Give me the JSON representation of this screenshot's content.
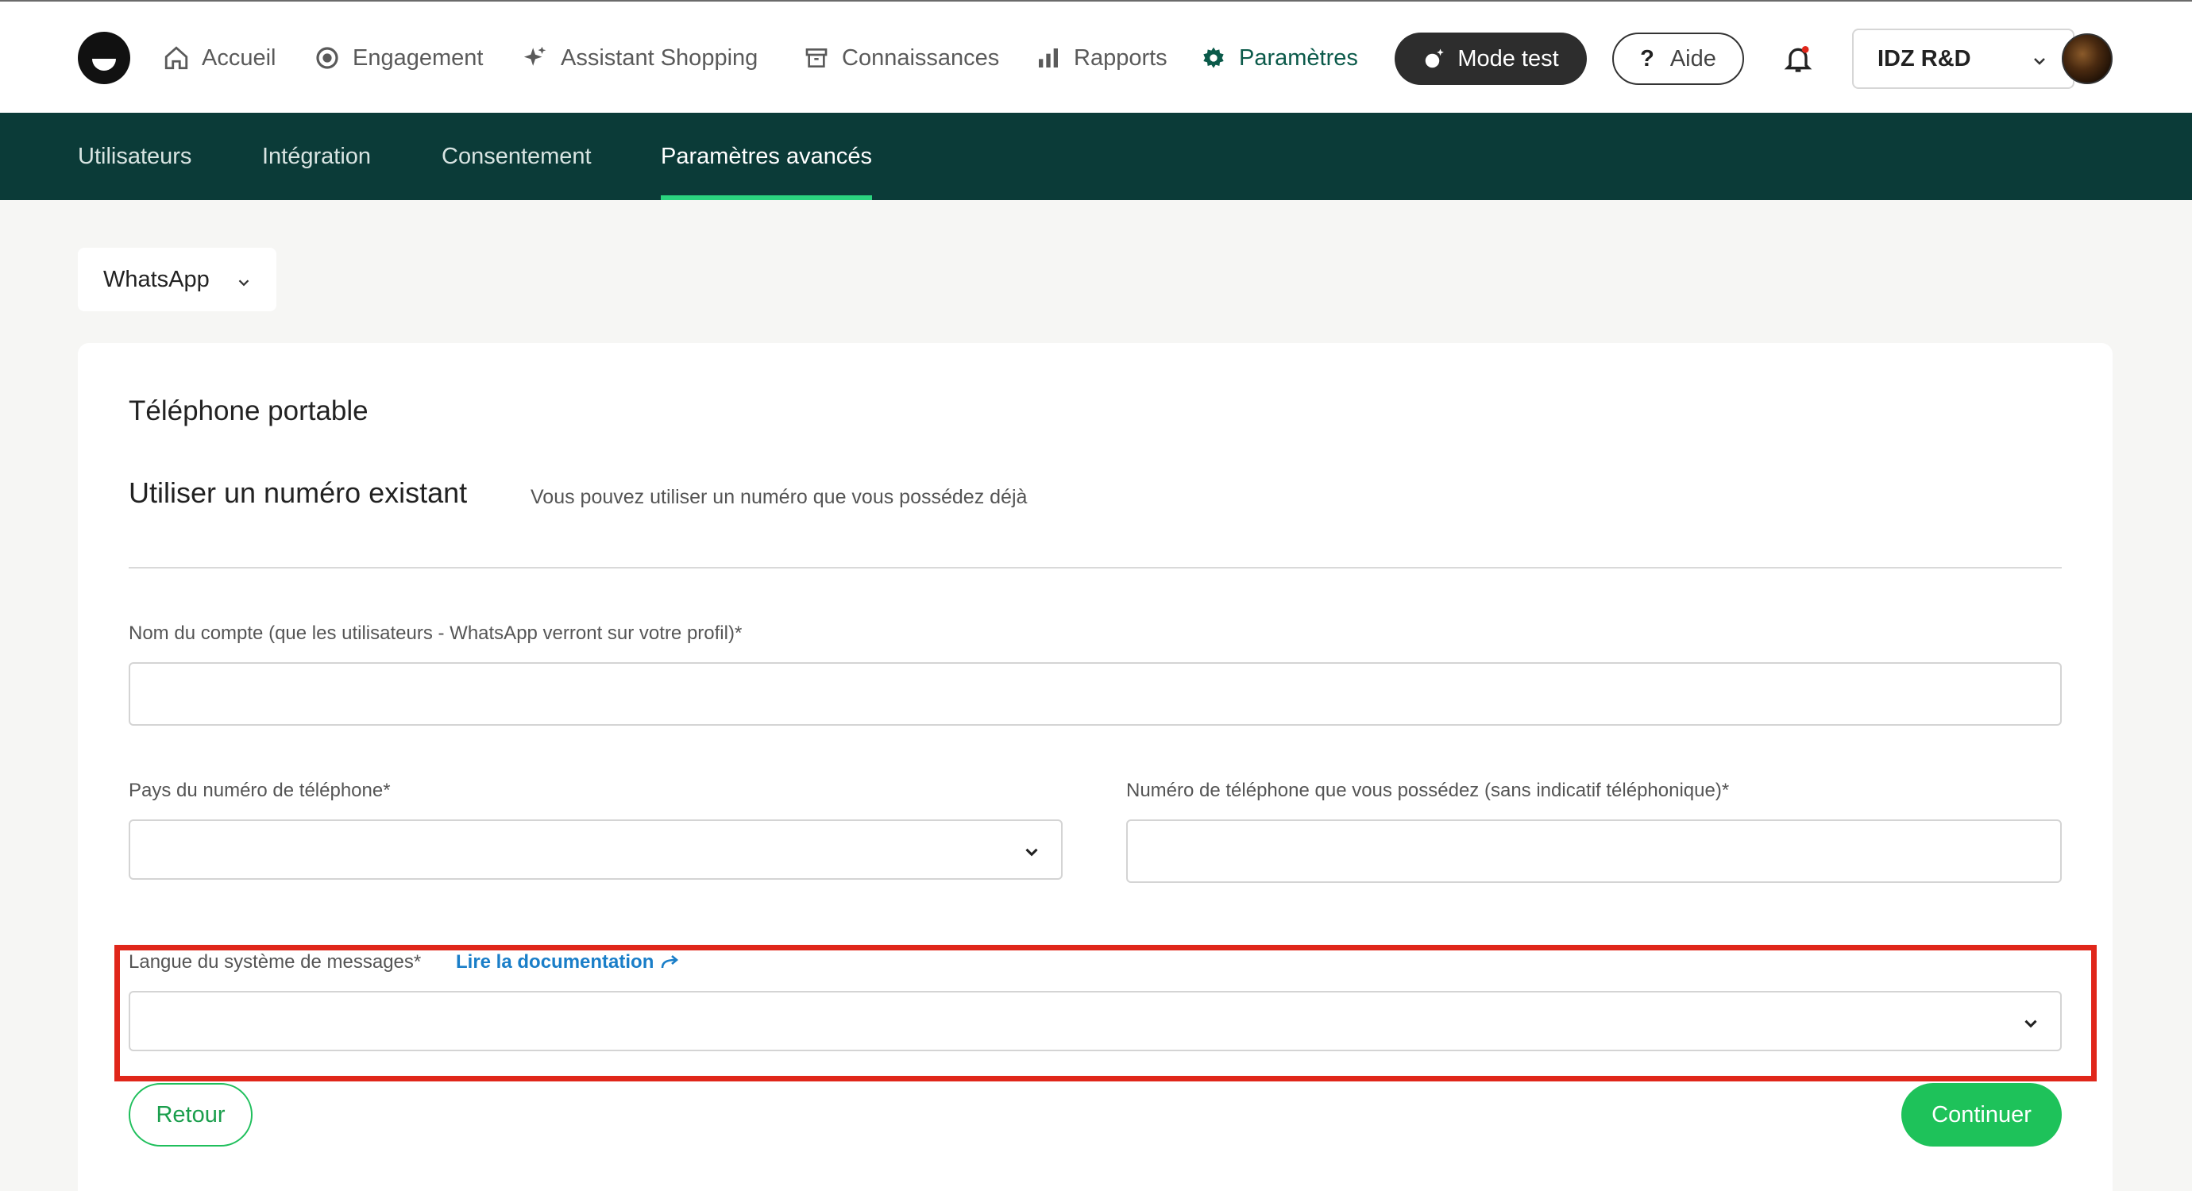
{
  "topnav": {
    "items": [
      {
        "label": "Accueil",
        "icon": "home-icon"
      },
      {
        "label": "Engagement",
        "icon": "target-icon"
      },
      {
        "label": "Assistant Shopping",
        "icon": "sparkle-icon"
      },
      {
        "label": "Connaissances",
        "icon": "archive-icon"
      },
      {
        "label": "Rapports",
        "icon": "bar-chart-icon"
      },
      {
        "label": "Paramètres",
        "icon": "gear-icon",
        "active": true
      }
    ],
    "mode_test_label": "Mode test",
    "help_label": "Aide",
    "org_name": "IDZ R&D",
    "accent_color": "#0b5a4a"
  },
  "subnav": {
    "items": [
      {
        "label": "Utilisateurs"
      },
      {
        "label": "Intégration"
      },
      {
        "label": "Consentement"
      },
      {
        "label": "Paramètres avancés",
        "active": true
      }
    ],
    "background": "#0b3b38",
    "active_underline": "#2bd37f"
  },
  "channel_select": {
    "value": "WhatsApp"
  },
  "form": {
    "card_title": "Téléphone portable",
    "section_title": "Utiliser un numéro existant",
    "section_desc": "Vous pouvez utiliser un numéro que vous possédez déjà",
    "account_name_label": "Nom du compte (que les utilisateurs - WhatsApp verront sur votre profil)*",
    "account_name_value": "",
    "country_label": "Pays du numéro de téléphone*",
    "country_value": "",
    "phone_label": "Numéro de téléphone que vous possédez (sans indicatif téléphonique)*",
    "phone_value": "",
    "language_label": "Langue du système de messages*",
    "doc_link_label": "Lire la documentation",
    "language_value": "",
    "back_label": "Retour",
    "continue_label": "Continuer",
    "highlight_color": "#e0261a"
  }
}
